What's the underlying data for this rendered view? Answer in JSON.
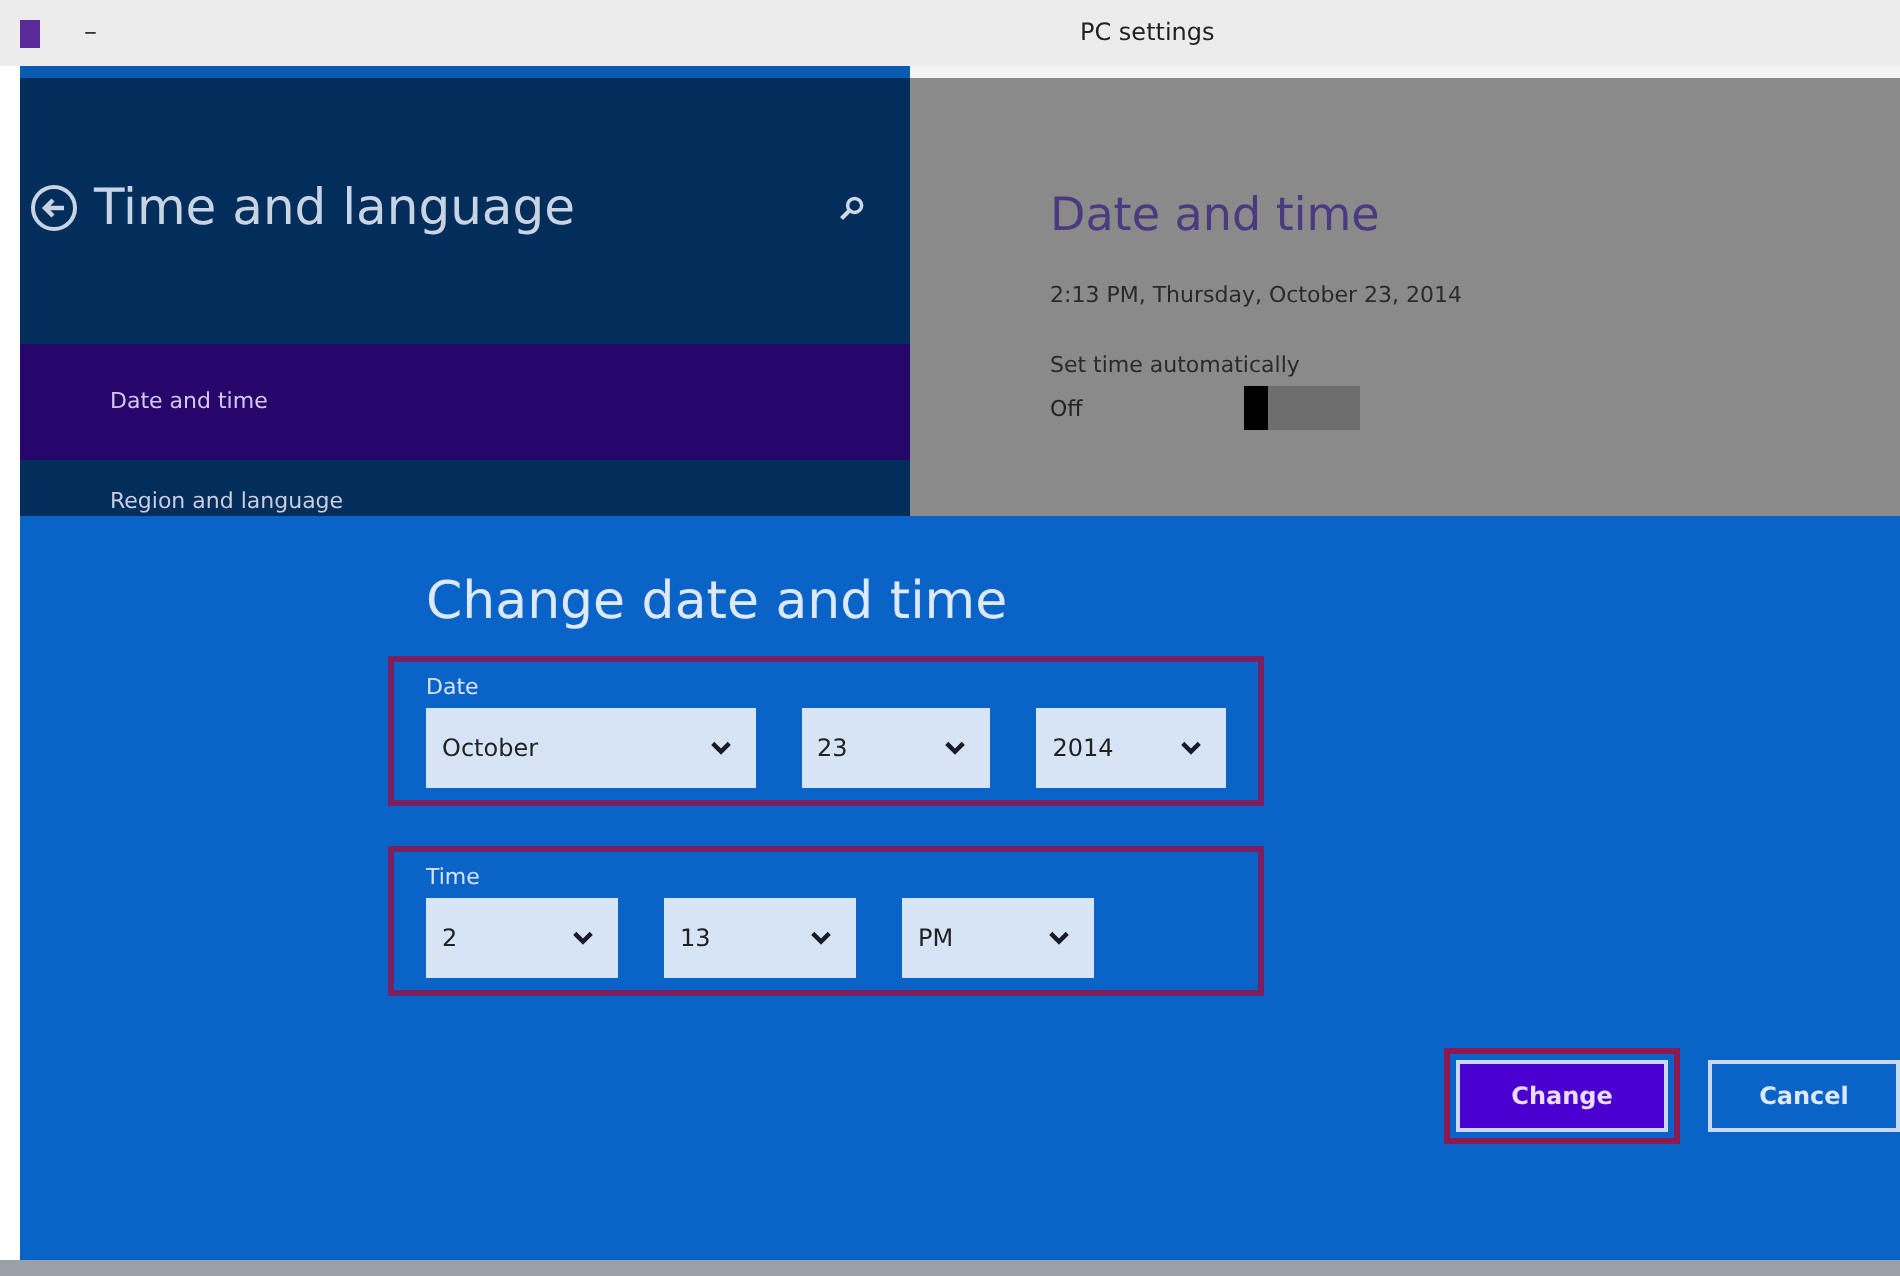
{
  "window": {
    "title": "PC settings",
    "menu_glyph": "–"
  },
  "sidebar": {
    "title": "Time and language",
    "items": [
      {
        "label": "Date and time",
        "selected": true
      },
      {
        "label": "Region and language",
        "selected": false
      }
    ]
  },
  "content": {
    "title": "Date and time",
    "current": "2:13 PM, Thursday, October 23, 2014",
    "auto_label": "Set time automatically",
    "auto_state": "Off",
    "auto_on": false
  },
  "dialog": {
    "title": "Change date and time",
    "groups": [
      {
        "label": "Date",
        "fields": [
          {
            "value": "October"
          },
          {
            "value": "23"
          },
          {
            "value": "2014"
          }
        ]
      },
      {
        "label": "Time",
        "fields": [
          {
            "value": "2"
          },
          {
            "value": "13"
          },
          {
            "value": "PM"
          }
        ]
      }
    ],
    "buttons": [
      {
        "label": "Change",
        "kind": "primary",
        "highlighted": true
      },
      {
        "label": "Cancel",
        "kind": "secondary",
        "highlighted": false
      }
    ]
  }
}
